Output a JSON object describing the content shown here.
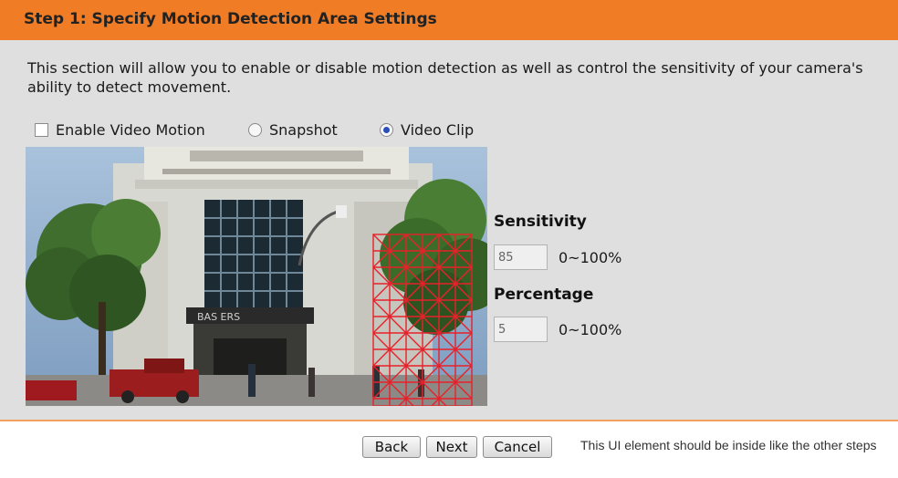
{
  "header": {
    "title": "Step 1: Specify Motion Detection Area Settings"
  },
  "description": "This section will allow you to enable or disable motion detection as well as control the sensitivity of your camera's ability to detect movement.",
  "options": {
    "enable_label": "Enable Video Motion",
    "enable_checked": false,
    "snapshot_label": "Snapshot",
    "snapshot_selected": false,
    "video_clip_label": "Video Clip",
    "video_clip_selected": true
  },
  "preview": {
    "storefront_sign": "BAS       ERS",
    "grid_color": "#e8202a"
  },
  "sensitivity": {
    "label": "Sensitivity",
    "value": "85",
    "range": "0~100%"
  },
  "percentage": {
    "label": "Percentage",
    "value": "5",
    "range": "0~100%"
  },
  "buttons": {
    "back": "Back",
    "next": "Next",
    "cancel": "Cancel"
  },
  "annotation": "This UI element should be inside like the other steps",
  "colors": {
    "header": "#f07c25",
    "panel": "#dfdfdf"
  }
}
